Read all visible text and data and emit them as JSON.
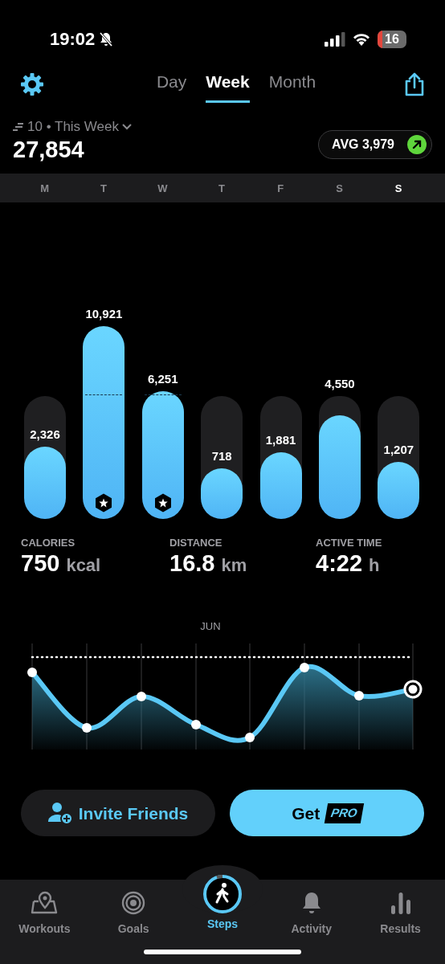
{
  "status_bar": {
    "time": "19:02",
    "battery": "16"
  },
  "header": {
    "tabs": [
      {
        "label": "Day",
        "selected": false
      },
      {
        "label": "Week",
        "selected": true
      },
      {
        "label": "Month",
        "selected": false
      }
    ]
  },
  "summary": {
    "period": "10 • This Week",
    "total": "27,854",
    "average": "AVG 3,979"
  },
  "days": [
    {
      "label": "M",
      "selected": false,
      "steps": "2,326",
      "badge": false
    },
    {
      "label": "T",
      "selected": false,
      "steps": "10,921",
      "badge": true
    },
    {
      "label": "W",
      "selected": false,
      "steps": "6,251",
      "badge": true
    },
    {
      "label": "T",
      "selected": false,
      "steps": "718",
      "badge": false
    },
    {
      "label": "F",
      "selected": false,
      "steps": "1,881",
      "badge": false
    },
    {
      "label": "S",
      "selected": false,
      "steps": "4,550",
      "badge": false
    },
    {
      "label": "S",
      "selected": true,
      "steps": "1,207",
      "badge": false
    }
  ],
  "stats": [
    {
      "label": "CALORIES",
      "value": "750",
      "unit": "kcal"
    },
    {
      "label": "DISTANCE",
      "value": "16.8",
      "unit": "km"
    },
    {
      "label": "ACTIVE TIME",
      "value": "4:22",
      "unit": "h"
    }
  ],
  "trend": {
    "month": "JUN"
  },
  "buttons": [
    {
      "kind": "secondary",
      "label": "Invite Friends"
    },
    {
      "kind": "primary",
      "label": "Get",
      "badge": "PRO"
    }
  ],
  "tab_bar": [
    {
      "label": "Workouts",
      "selected": false
    },
    {
      "label": "Goals",
      "selected": false
    },
    {
      "label": "Steps",
      "selected": true
    },
    {
      "label": "Activity",
      "selected": false
    },
    {
      "label": "Results",
      "selected": false
    }
  ]
}
